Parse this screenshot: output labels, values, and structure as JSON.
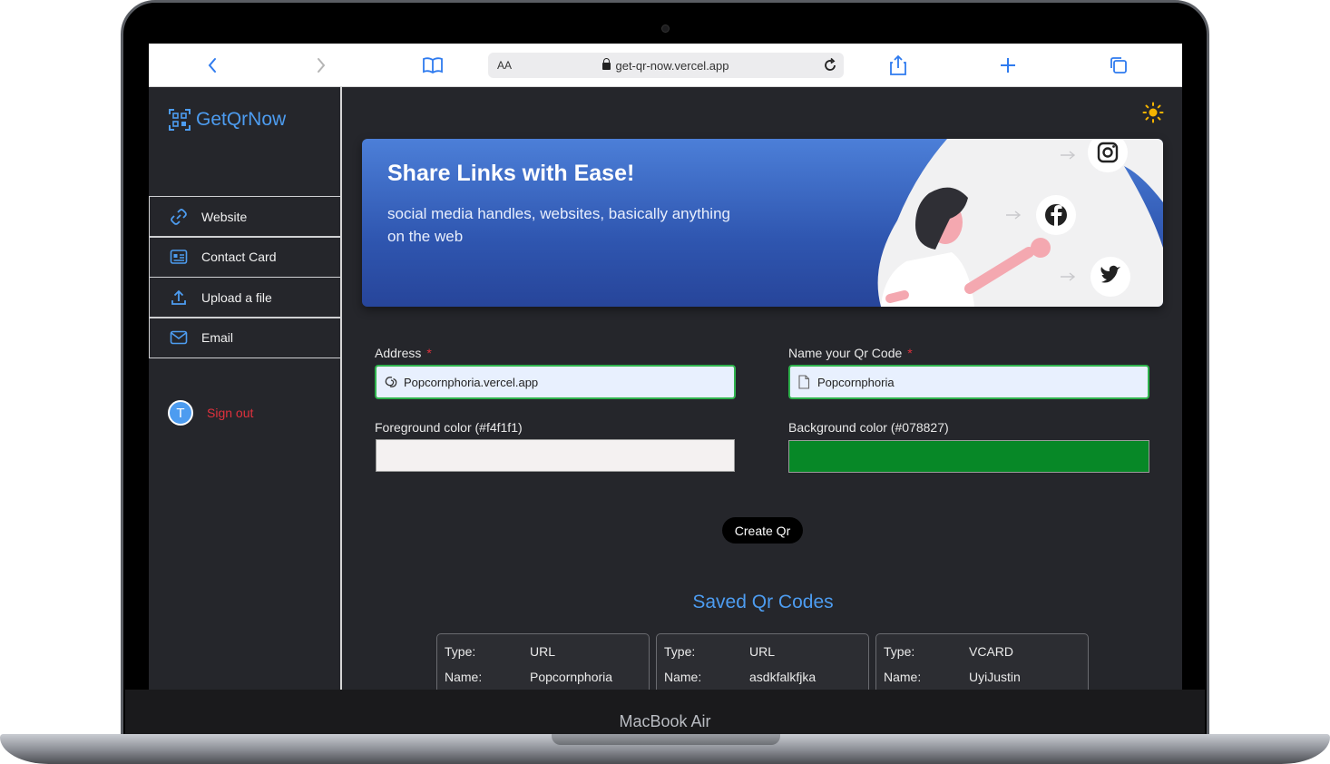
{
  "device": {
    "brand_label": "MacBook Air"
  },
  "browser": {
    "aa_label": "AA",
    "url": "get-qr-now.vercel.app"
  },
  "sidebar": {
    "logo_text": "GetQrNow",
    "items": [
      {
        "label": "Website",
        "icon": "link-icon"
      },
      {
        "label": "Contact Card",
        "icon": "contact-card-icon"
      },
      {
        "label": "Upload a file",
        "icon": "upload-icon"
      },
      {
        "label": "Email",
        "icon": "mail-icon"
      }
    ],
    "avatar_initial": "T",
    "signout_label": "Sign out"
  },
  "banner": {
    "title": "Share Links with Ease!",
    "subtitle": "social media handles, websites, basically anything on the web"
  },
  "form": {
    "address_label": "Address",
    "address_value": "Popcornphoria.vercel.app",
    "name_label": "Name your Qr Code",
    "name_value": "Popcornphoria",
    "required_mark": "*",
    "fg_label": "Foreground color (#f4f1f1)",
    "fg_color": "#f4f1f1",
    "bg_label": "Background color (#078827)",
    "bg_color": "#078827",
    "submit_label": "Create Qr"
  },
  "saved": {
    "title": "Saved Qr Codes",
    "type_key": "Type:",
    "name_key": "Name:",
    "cards": [
      {
        "type": "URL",
        "name": "Popcornphoria"
      },
      {
        "type": "URL",
        "name": "asdkfalkfjka"
      },
      {
        "type": "VCARD",
        "name": "UyiJustin"
      }
    ]
  },
  "colors": {
    "accent": "#4d9cf0",
    "background": "#25262b",
    "danger": "#e0313d",
    "input_border": "#2fb34d"
  }
}
